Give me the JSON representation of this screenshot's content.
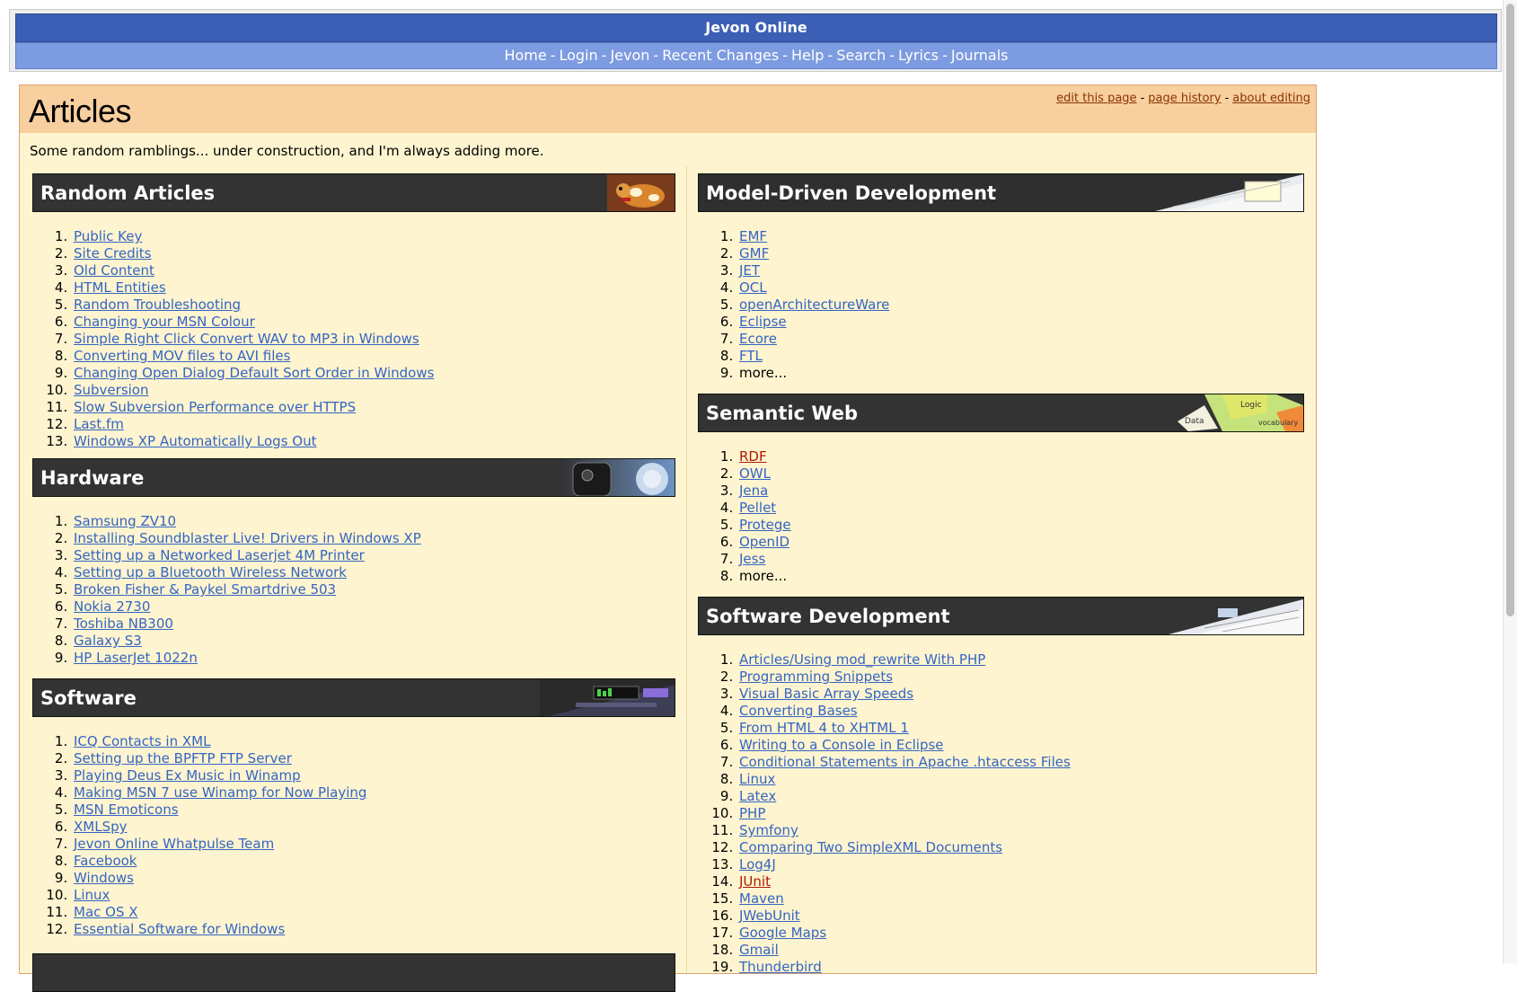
{
  "site": {
    "title": "Jevon Online",
    "nav": [
      "Home",
      "Login",
      "Jevon",
      "Recent Changes",
      "Help",
      "Search",
      "Lyrics",
      "Journals"
    ]
  },
  "page": {
    "title": "Articles",
    "actions": [
      "edit this page",
      "page history",
      "about editing"
    ],
    "intro": "Some random ramblings... under construction, and I'm always adding more."
  },
  "sections": {
    "random": {
      "title": "Random Articles",
      "items": [
        "Public Key",
        "Site Credits",
        "Old Content",
        "HTML Entities",
        "Random Troubleshooting",
        "Changing your MSN Colour",
        "Simple Right Click Convert WAV to MP3 in Windows",
        "Converting MOV files to AVI files",
        "Changing Open Dialog Default Sort Order in Windows",
        "Subversion",
        "Slow Subversion Performance over HTTPS",
        "Last.fm",
        "Windows XP Automatically Logs Out"
      ]
    },
    "hardware": {
      "title": "Hardware",
      "items": [
        "Samsung ZV10",
        "Installing Soundblaster Live! Drivers in Windows XP",
        "Setting up a Networked Laserjet 4M Printer",
        "Setting up a Bluetooth Wireless Network",
        "Broken Fisher & Paykel Smartdrive 503",
        "Nokia 2730",
        "Toshiba NB300",
        "Galaxy S3",
        "HP LaserJet 1022n"
      ]
    },
    "software": {
      "title": "Software",
      "items": [
        "ICQ Contacts in XML",
        "Setting up the BPFTP FTP Server",
        "Playing Deus Ex Music in Winamp",
        "Making MSN 7 use Winamp for Now Playing",
        "MSN Emoticons",
        "XMLSpy",
        "Jevon Online Whatpulse Team",
        "Facebook",
        "Windows",
        "Linux",
        "Mac OS X",
        "Essential Software for Windows"
      ]
    },
    "mdd": {
      "title": "Model-Driven Development",
      "items": [
        "EMF",
        "GMF",
        "JET",
        "OCL",
        "openArchitectureWare",
        "Eclipse",
        "Ecore",
        "FTL"
      ],
      "more": "more..."
    },
    "semweb": {
      "title": "Semantic Web",
      "items": [
        "RDF",
        "OWL",
        "Jena",
        "Pellet",
        "Protege",
        "OpenID",
        "Jess"
      ],
      "more": "more...",
      "missing": [
        "RDF"
      ],
      "image_words": [
        "Data",
        "Logic",
        "vocabulary"
      ]
    },
    "softdev": {
      "title": "Software Development",
      "items": [
        "Articles/Using mod_rewrite With PHP",
        "Programming Snippets",
        "Visual Basic Array Speeds",
        "Converting Bases",
        "From HTML 4 to XHTML 1",
        "Writing to a Console in Eclipse",
        "Conditional Statements in Apache .htaccess Files",
        "Linux",
        "Latex",
        "PHP",
        "Symfony",
        "Comparing Two SimpleXML Documents",
        "Log4J",
        "JUnit",
        "Maven",
        "JWebUnit",
        "Google Maps",
        "Gmail",
        "Thunderbird"
      ],
      "missing": [
        "JUnit"
      ]
    }
  },
  "colors": {
    "header_blue": "#3b5fb5",
    "nav_blue": "#7d9be0",
    "content_bg": "#fef4cf",
    "title_band": "#f8cf9f",
    "section_head": "#333333",
    "link": "#3465c4",
    "missing_link": "#b01a00"
  }
}
